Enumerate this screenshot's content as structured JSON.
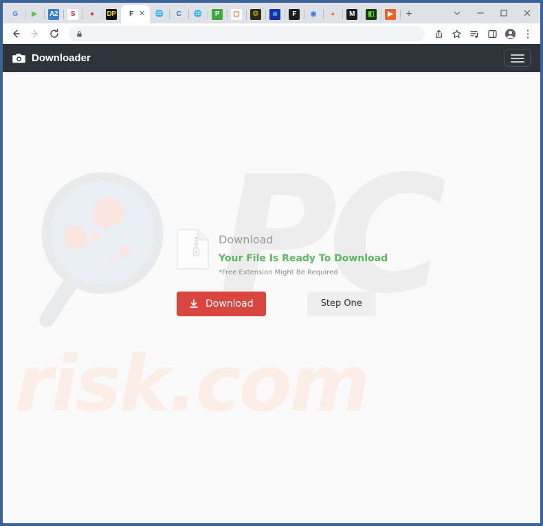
{
  "browser": {
    "tabs": [
      {
        "favicon": "google-g-icon",
        "glyph": "G",
        "fg": "#4285f4",
        "bg": "transparent"
      },
      {
        "favicon": "green-play-icon",
        "glyph": "▶",
        "fg": "#5fbf4a",
        "bg": "transparent"
      },
      {
        "favicon": "a2-blue-icon",
        "glyph": "A2",
        "fg": "#ffffff",
        "bg": "#3c7fd0"
      },
      {
        "favicon": "red-s-icon",
        "glyph": "S",
        "fg": "#d62b2b",
        "bg": "#ffffff"
      },
      {
        "favicon": "red-circle-icon",
        "glyph": "●",
        "fg": "#e03131",
        "bg": "transparent"
      },
      {
        "favicon": "dp-black-icon",
        "glyph": "DP",
        "fg": "#ffd400",
        "bg": "#111111"
      },
      {
        "favicon": "globe-gray-icon",
        "glyph": "🌐",
        "fg": "#4a4a4a",
        "bg": "transparent"
      },
      {
        "favicon": "blue-c-icon",
        "glyph": "C",
        "fg": "#2d6fd4",
        "bg": "transparent"
      },
      {
        "favicon": "globe-gray-icon",
        "glyph": "🌐",
        "fg": "#4a4a4a",
        "bg": "transparent"
      },
      {
        "favicon": "p-green-icon",
        "glyph": "P",
        "fg": "#ffffff",
        "bg": "#3fa83f"
      },
      {
        "favicon": "orange-square-icon",
        "glyph": "▢",
        "fg": "#ec6318",
        "bg": "#ffffff"
      },
      {
        "favicon": "olive-badge-icon",
        "glyph": "❂",
        "fg": "#9a8818",
        "bg": "#2c2a10"
      },
      {
        "favicon": "blue-square-icon",
        "glyph": "◙",
        "fg": "#30b0e8",
        "bg": "#1a2ea8"
      },
      {
        "favicon": "f-black-icon",
        "glyph": "F",
        "fg": "#ffffff",
        "bg": "#1d1d1d"
      },
      {
        "favicon": "blue-spiral-icon",
        "glyph": "◉",
        "fg": "#3b7fd8",
        "bg": "transparent"
      },
      {
        "favicon": "orange-flame-icon",
        "glyph": "◕",
        "fg": "#e8631a",
        "bg": "transparent"
      },
      {
        "favicon": "m-black-icon",
        "glyph": "M",
        "fg": "#ffffff",
        "bg": "#1d1d1d"
      },
      {
        "favicon": "green-app-icon",
        "glyph": "◧",
        "fg": "#6dd13a",
        "bg": "#153a0c"
      },
      {
        "favicon": "orange-play-icon",
        "glyph": "▶",
        "fg": "#ffffff",
        "bg": "#ea6322"
      }
    ],
    "active_tab": {
      "favicon": "f-letter-icon",
      "glyph": "F",
      "title": "F",
      "close_label": "✕"
    },
    "new_tab_label": "+",
    "window_controls": {
      "tab_search": "⌄",
      "minimize": "–",
      "maximize": "□",
      "close": "✕"
    },
    "toolbar": {
      "back_label": "←",
      "forward_label": "→",
      "reload_label": "⟳",
      "lock_icon": "lock-icon",
      "url_value": "",
      "url_placeholder": "",
      "share_label": "share-icon",
      "bookmark_label": "star-icon",
      "reading_list_label": "reading-list-icon",
      "side_panel_label": "side-panel-icon",
      "profile_label": "profile-icon",
      "menu_label": "⋮"
    }
  },
  "site": {
    "brand_name": "Downloader",
    "brand_icon": "camera-icon",
    "menu_toggle": "hamburger-menu-icon",
    "colors": {
      "navbar_bg": "#2f343a",
      "download_button": "#d9453f",
      "ready_text": "#5cb85c",
      "page_bg": "#fafafa"
    },
    "watermark": {
      "pc_text": "PC",
      "risk_text": "risk.com",
      "glass_icon": "magnifying-glass-icon"
    },
    "download_card": {
      "file_icon": "zip-file-icon",
      "heading": "Download",
      "ready_message": "Your File Is Ready To Download",
      "note": "*Free Extension Might Be Required",
      "download_button_label": "Download",
      "download_button_icon": "download-icon",
      "step_button_label": "Step One"
    }
  }
}
